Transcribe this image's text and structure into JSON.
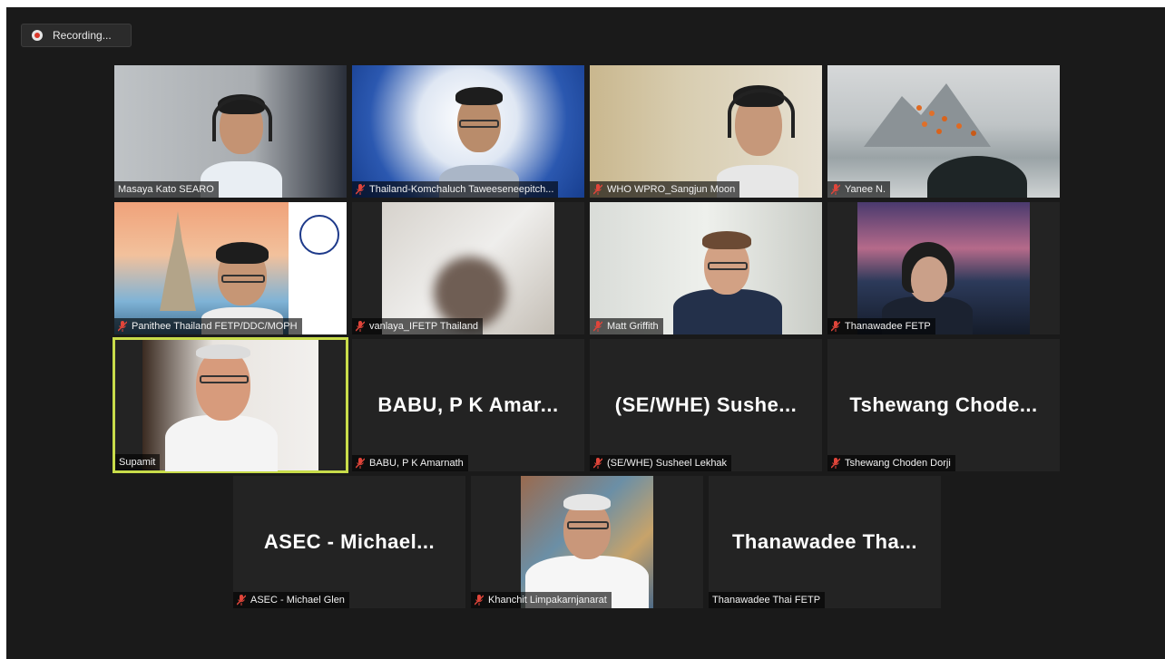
{
  "recording": {
    "label": "Recording..."
  },
  "tiles": [
    {
      "label": "Masaya Kato SEARO",
      "muted": false
    },
    {
      "label": "Thailand-Komchaluch Taweeseneepitch...",
      "muted": true
    },
    {
      "label": "WHO WPRO_Sangjun Moon",
      "muted": true
    },
    {
      "label": "Yanee N.",
      "muted": true
    },
    {
      "label": "Panithee Thailand FETP/DDC/MOPH",
      "muted": true
    },
    {
      "label": "vanlaya_IFETP Thailand",
      "muted": true
    },
    {
      "label": "Matt Griffith",
      "muted": true
    },
    {
      "label": "Thanawadee FETP",
      "muted": true
    },
    {
      "label": "Supamit",
      "muted": false,
      "active": true
    },
    {
      "label": "BABU, P K Amarnath",
      "muted": true,
      "display_name": "BABU, P K Amar..."
    },
    {
      "label": "(SE/WHE) Susheel Lekhak",
      "muted": true,
      "display_name": "(SE/WHE) Sushe..."
    },
    {
      "label": "Tshewang Choden Dorji",
      "muted": true,
      "display_name": "Tshewang Chode..."
    },
    {
      "label": "ASEC - Michael Glen",
      "muted": true,
      "display_name": "ASEC - Michael..."
    },
    {
      "label": "Khanchit Limpakarnjanarat",
      "muted": true
    },
    {
      "label": "Thanawadee Thai FETP",
      "muted": false,
      "display_name": "Thanawadee Tha..."
    }
  ],
  "colors": {
    "active_border": "#c8dc4a",
    "muted_icon": "#e0453a",
    "record_dot": "#d9372a"
  },
  "icons": {
    "mic_muted": "mic-muted-icon",
    "record": "record-icon"
  }
}
